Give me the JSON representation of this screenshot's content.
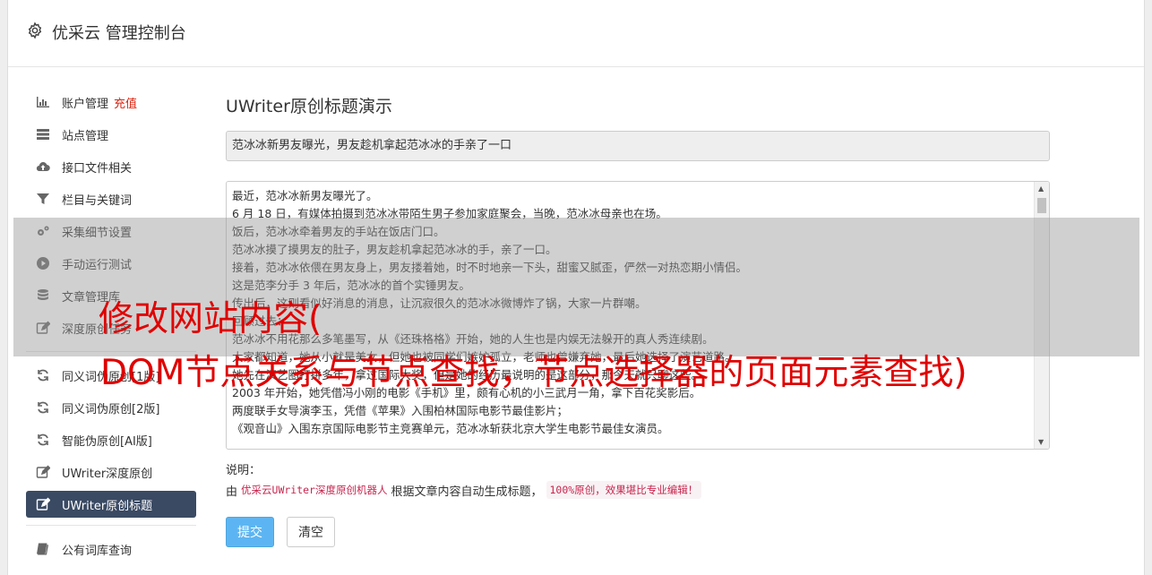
{
  "header": {
    "title": "优采云 管理控制台",
    "icon": "gear-icon"
  },
  "sidebar": {
    "group1": [
      {
        "label": "账户管理",
        "badge": "充值",
        "icon": "bar-chart-icon"
      },
      {
        "label": "站点管理",
        "icon": "server-icon"
      },
      {
        "label": "接口文件相关",
        "icon": "cloud-upload-icon"
      },
      {
        "label": "栏目与关键词",
        "icon": "filter-icon"
      },
      {
        "label": "采集细节设置",
        "icon": "gears-icon"
      },
      {
        "label": "手动运行测试",
        "icon": "play-circle-icon"
      },
      {
        "label": "文章管理库",
        "icon": "database-icon"
      },
      {
        "label": "深度原创任务",
        "icon": "edit-icon"
      }
    ],
    "group2": [
      {
        "label": "同义词伪原创[1版]",
        "icon": "refresh-icon"
      },
      {
        "label": "同义词伪原创[2版]",
        "icon": "refresh-icon"
      },
      {
        "label": "智能伪原创[AI版]",
        "icon": "refresh-icon"
      },
      {
        "label": "UWriter深度原创",
        "icon": "edit-icon"
      },
      {
        "label": "UWriter原创标题",
        "icon": "edit-icon",
        "active": true
      }
    ],
    "group3": [
      {
        "label": "公有词库查询",
        "icon": "book-icon"
      }
    ]
  },
  "main": {
    "heading": "UWriter原创标题演示",
    "title_value": "范冰冰新男友曝光，男友趁机拿起范冰冰的手亲了一口",
    "body_lines": [
      "最近，范冰冰新男友曝光了。",
      "6 月 18 日，有媒体拍摄到范冰冰带陌生男子参加家庭聚会，当晚，范冰冰母亲也在场。",
      "饭后，范冰冰牵着男友的手站在饭店门口。",
      "范冰冰摸了摸男友的肚子，男友趁机拿起范冰冰的手，亲了一口。",
      "接着，范冰冰依偎在男友身上，男友搂着她，时不时地亲一下头，甜蜜又腻歪，俨然一对热恋期小情侣。",
      "这是范李分手 3 年后，范冰冰的首个实锤男友。",
      "传出后，这则看似好消息的消息，让沉寂很久的范冰冰微博炸了锅，大家一片群嘲。",
      "回顾过去：",
      "范冰冰不用花那么多笔墨写，从《还珠格格》开始，她的人生也是内娱无法躲开的真人秀连续剧。",
      "大家都知道，她从小就是美女，但她也被同学们嫉妒孤立，老师也曾嫌弃她，最后她选择了演艺道路。",
      "她先在演艺圈打拼多年，拿过国际大奖，但是她的经历最说明的是这部分，那今天就只聊这些。",
      "2003 年开始，她凭借冯小刚的电影《手机》里，颇有心机的小三武月一角，拿下百花奖影后。",
      "两度联手女导演李玉，凭借《苹果》入围柏林国际电影节最佳影片；",
      "《观音山》入围东京国际电影节主竞赛单元，范冰冰斩获北京大学生电影节最佳女演员。"
    ],
    "desc_label": "说明：",
    "desc_prefix": "由",
    "desc_product": "优采云UWriter深度原创机器人",
    "desc_middle": "根据文章内容自动生成标题，",
    "desc_highlight": "100%原创，效果堪比专业编辑！",
    "submit_label": "提交",
    "clear_label": "清空"
  },
  "watermark": {
    "line1": "修改网站内容(",
    "line2": "DOM节点关系与节点查找，节点选择器的页面元素查找)"
  }
}
